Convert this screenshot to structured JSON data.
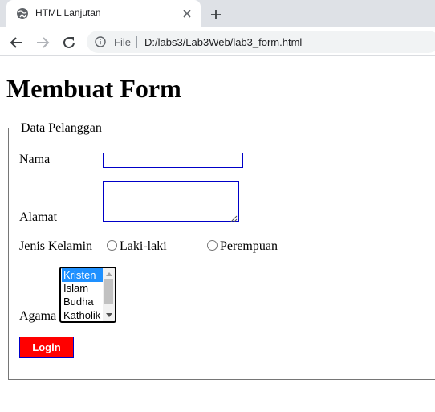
{
  "browser": {
    "tab_title": "HTML Lanjutan",
    "url_prefix": "File",
    "url": "D:/labs3/Lab3Web/lab3_form.html"
  },
  "page": {
    "heading": "Membuat Form",
    "legend": "Data Pelanggan",
    "form": {
      "nama_label": "Nama",
      "nama_value": "",
      "alamat_label": "Alamat",
      "alamat_value": "",
      "gender_label": "Jenis Kelamin",
      "gender_options": [
        "Laki-laki",
        "Perempuan"
      ],
      "agama_label": "Agama",
      "agama_options": [
        "Kristen",
        "Islam",
        "Budha",
        "Katholik"
      ],
      "agama_selected": "Kristen",
      "submit_label": "Login"
    }
  },
  "colors": {
    "submit_bg": "#ff0000",
    "input_border": "#0000c8",
    "selected_option_bg": "#1e90ff"
  }
}
